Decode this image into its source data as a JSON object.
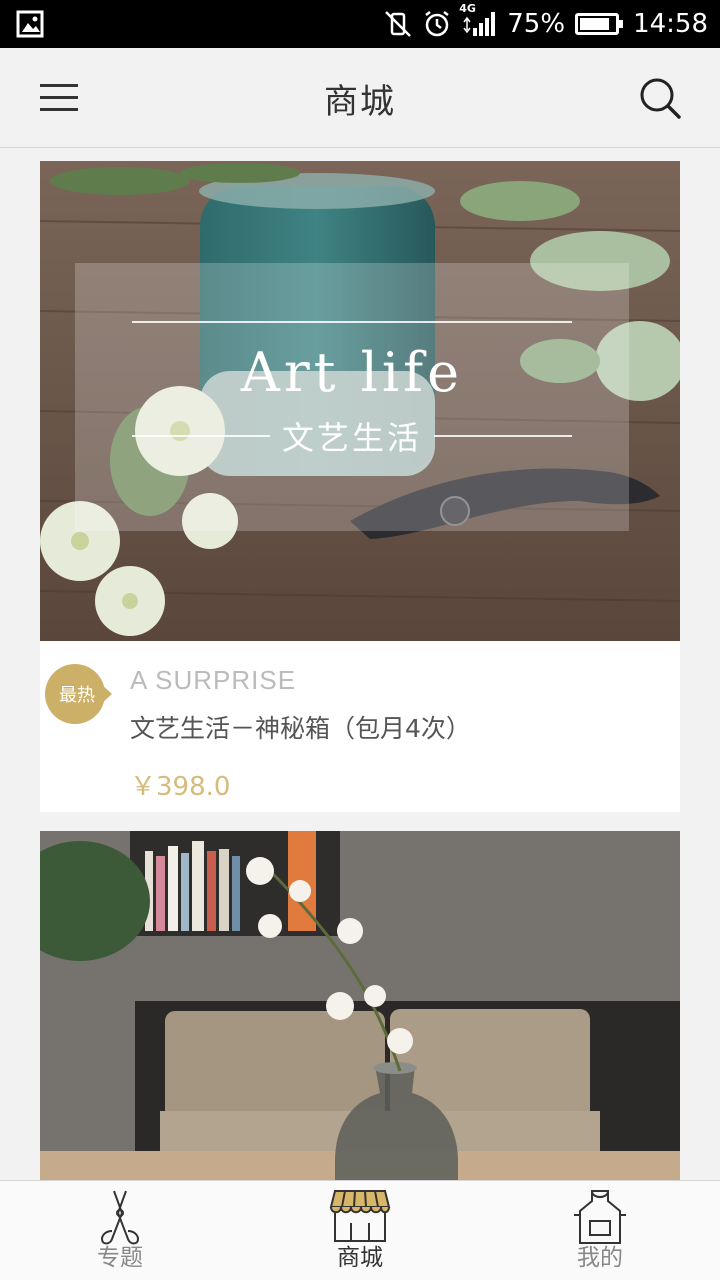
{
  "status_bar": {
    "battery": "75%",
    "time": "14:58",
    "network": "4G"
  },
  "header": {
    "title": "商城"
  },
  "products": [
    {
      "banner_title": "Art life",
      "banner_subtitle": "文艺生活",
      "badge": "最热",
      "subtitle": "A SURPRISE",
      "name": "文艺生活－神秘箱（包月4次）",
      "price": "￥398.0"
    }
  ],
  "bottom_nav": {
    "tabs": [
      {
        "label": "专题",
        "icon": "pruning-shears-icon"
      },
      {
        "label": "商城",
        "icon": "shop-awning-icon"
      },
      {
        "label": "我的",
        "icon": "apron-icon"
      }
    ]
  },
  "colors": {
    "accent": "#cdb068",
    "price": "#d6bc7c",
    "background": "#f2f2f2"
  }
}
